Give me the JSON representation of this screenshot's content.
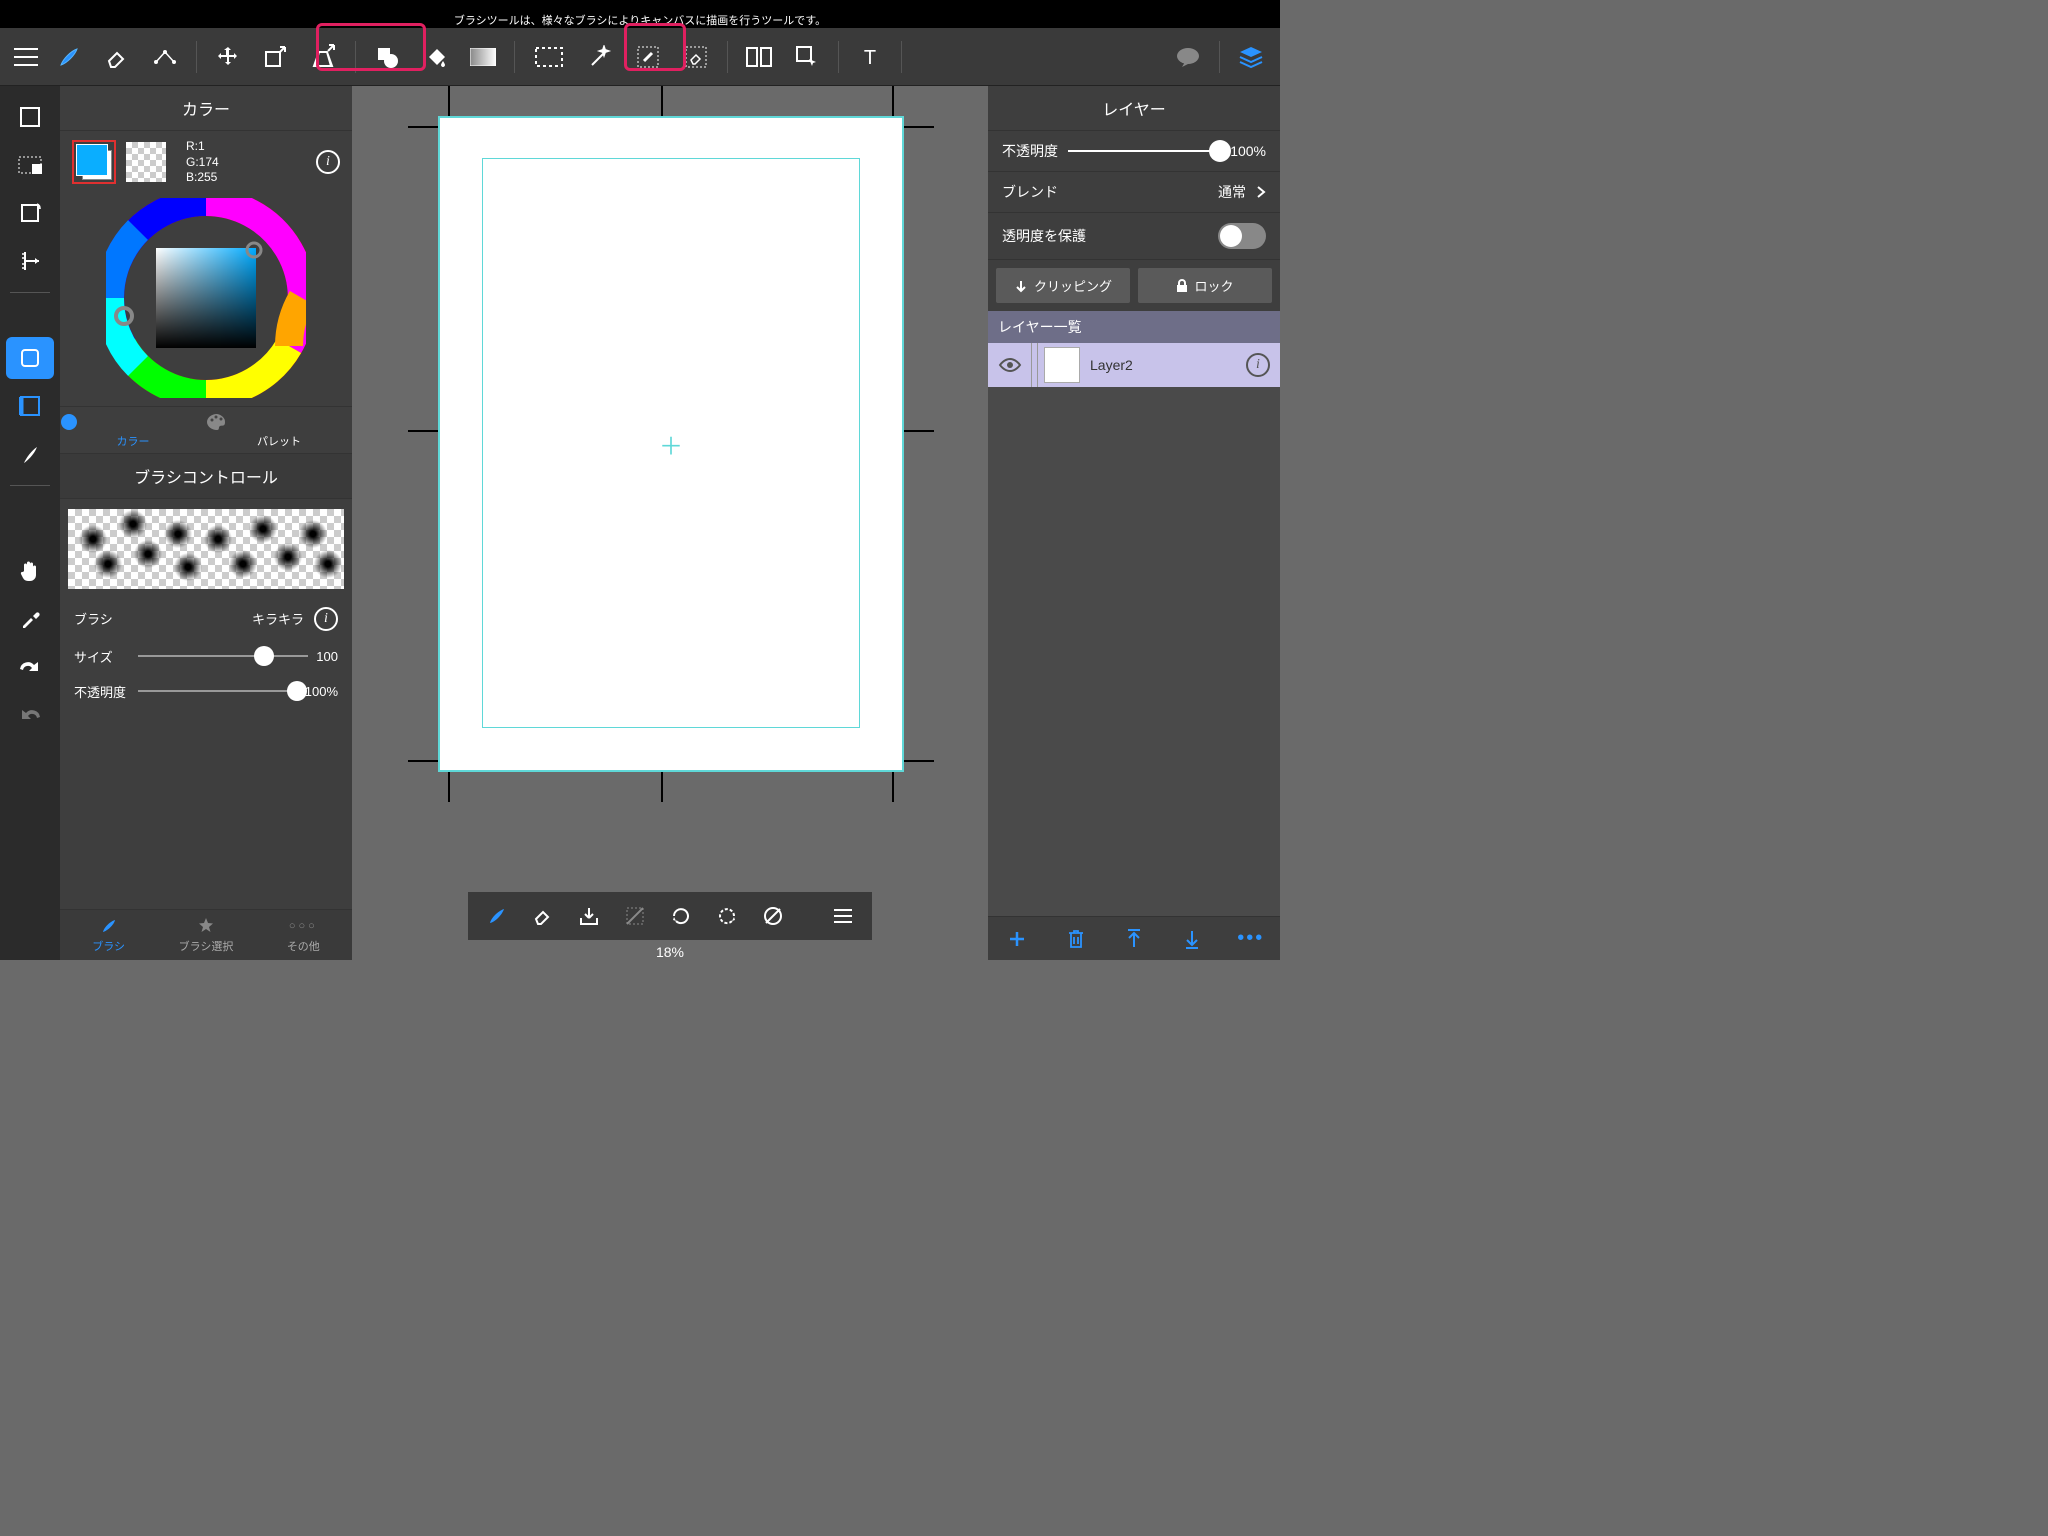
{
  "tooltip": "ブラシツールは、様々なブラシによりキャンバスに描画を行うツールです。",
  "leftPanel": {
    "colorTitle": "カラー",
    "rgb": {
      "r": "R:1",
      "g": "G:174",
      "b": "B:255"
    },
    "tabColor": "カラー",
    "tabPalette": "パレット",
    "brushControlTitle": "ブラシコントロール",
    "brushLabel": "ブラシ",
    "brushName": "キラキラ",
    "sizeLabel": "サイズ",
    "sizeValue": "100",
    "opacityLabel": "不透明度",
    "opacityValue": "100%",
    "bottomTabs": {
      "brush": "ブラシ",
      "brushSelect": "ブラシ選択",
      "other": "その他"
    }
  },
  "canvas": {
    "zoom": "18%"
  },
  "rightPanel": {
    "title": "レイヤー",
    "opacityLabel": "不透明度",
    "opacityValue": "100%",
    "blendLabel": "ブレンド",
    "blendValue": "通常",
    "protectLabel": "透明度を保護",
    "clippingBtn": "クリッピング",
    "lockBtn": "ロック",
    "layerListHeader": "レイヤー一覧",
    "layer1Name": "Layer2"
  }
}
